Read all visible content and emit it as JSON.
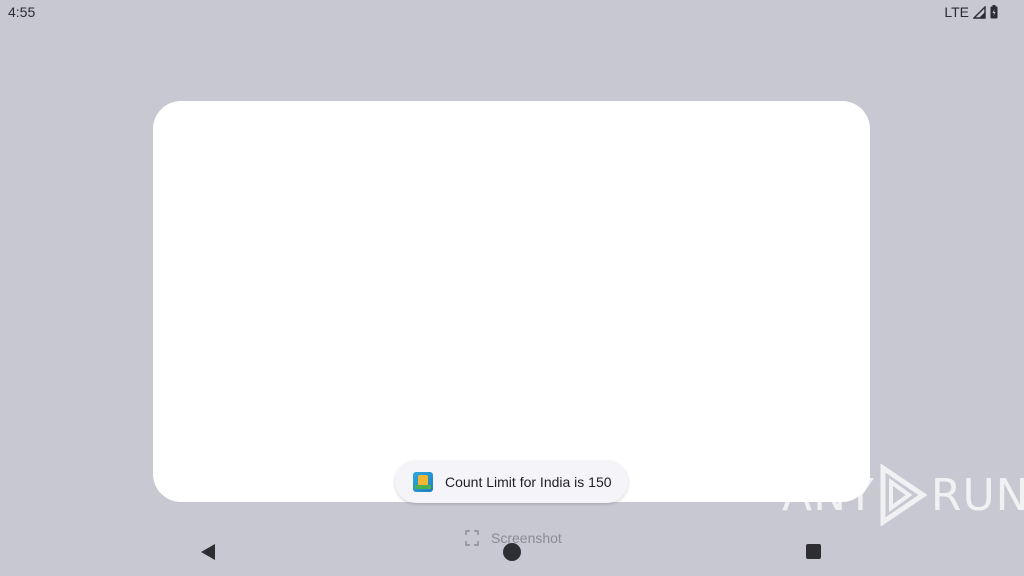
{
  "status_bar": {
    "time": "4:55",
    "network": "LTE",
    "icons": [
      "signal-icon",
      "battery-icon"
    ]
  },
  "toast": {
    "app_icon": "app-icon",
    "message": "Count Limit for India is 150"
  },
  "screenshot_hint": {
    "icon": "screenshot-icon",
    "label": "Screenshot"
  },
  "navigation": {
    "back_icon": "back-icon",
    "home_icon": "home-icon",
    "recents_icon": "recents-icon"
  },
  "watermark": {
    "left_text": "ANY",
    "right_text": "RUN"
  },
  "colors": {
    "background": "#c7c8d2",
    "card": "#ffffff",
    "toast": "#f5f5f9",
    "nav": "#2d2d33"
  }
}
